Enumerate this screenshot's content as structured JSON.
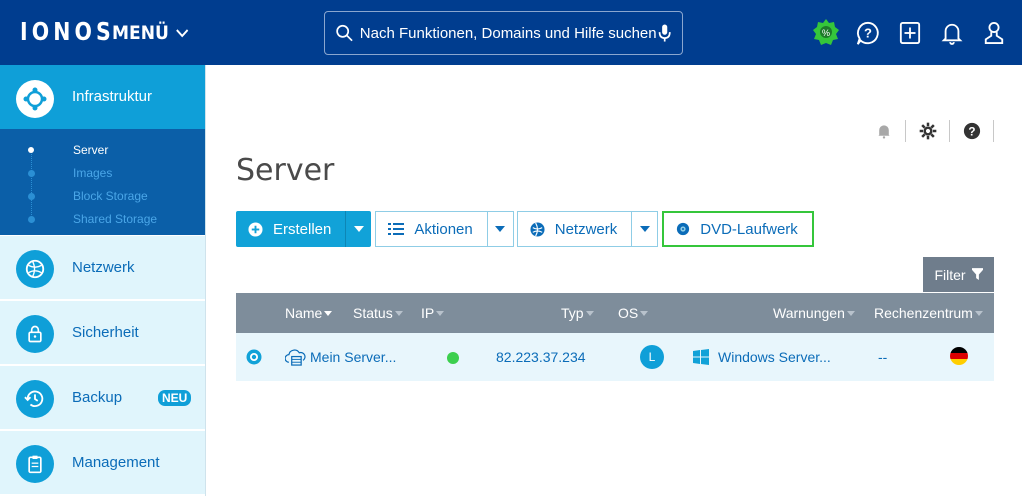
{
  "header": {
    "logo": "IONOS",
    "menu_label": "MENÜ",
    "search_placeholder": "Nach Funktionen, Domains und Hilfe suchen"
  },
  "sidebar": {
    "active": {
      "label": "Infrastruktur"
    },
    "sub_items": [
      {
        "label": "Server"
      },
      {
        "label": "Images"
      },
      {
        "label": "Block Storage"
      },
      {
        "label": "Shared Storage"
      }
    ],
    "items": [
      {
        "label": "Netzwerk"
      },
      {
        "label": "Sicherheit"
      },
      {
        "label": "Backup",
        "badge": "NEU"
      },
      {
        "label": "Management"
      }
    ]
  },
  "main": {
    "title": "Server",
    "toolbar": {
      "create": "Erstellen",
      "actions": "Aktionen",
      "network": "Netzwerk",
      "dvd": "DVD-Laufwerk"
    },
    "filter": "Filter",
    "columns": {
      "name": "Name",
      "status": "Status",
      "ip": "IP",
      "type": "Typ",
      "os": "OS",
      "warnings": "Warnungen",
      "datacenter": "Rechenzentrum"
    },
    "rows": [
      {
        "name": "Mein Server...",
        "status_color": "#3ccf4e",
        "ip": "82.223.37.234",
        "os_letter": "L",
        "os_name": "Windows Server...",
        "datacenter": "--"
      }
    ]
  },
  "colors": {
    "topbar": "#003d8f",
    "accent": "#11a2d8",
    "highlight_border": "#35c63b"
  }
}
